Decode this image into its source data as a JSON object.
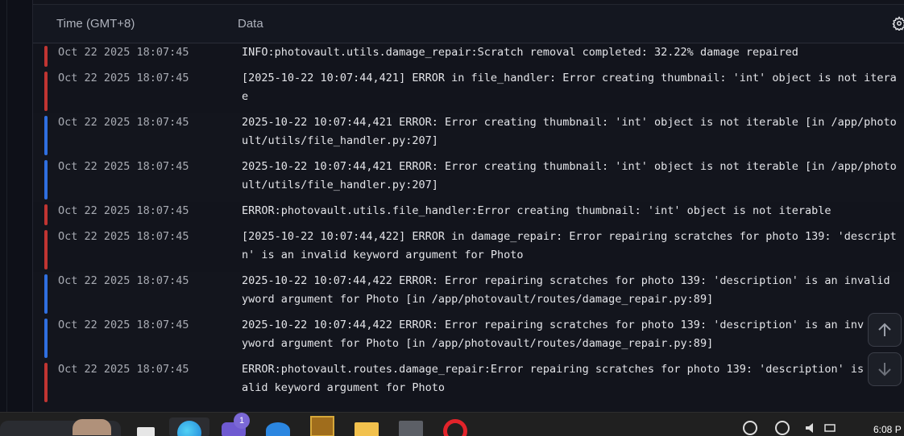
{
  "header": {
    "time_col": "Time (GMT+8)",
    "data_col": "Data"
  },
  "colors": {
    "error": "#c03532",
    "info": "#2f6fe0"
  },
  "rows": [
    {
      "level": "error",
      "time": "Oct 22 2025 18:07:45",
      "lines": [
        "INFO:photovault.utils.damage_repair:Scratch removal completed: 32.22% damage repaired"
      ]
    },
    {
      "level": "error",
      "time": "Oct 22 2025 18:07:45",
      "lines": [
        "[2025-10-22 10:07:44,421] ERROR in file_handler: Error creating thumbnail: 'int' object is not itera",
        "e"
      ]
    },
    {
      "level": "info",
      "time": "Oct 22 2025 18:07:45",
      "lines": [
        "2025-10-22 10:07:44,421 ERROR: Error creating thumbnail: 'int' object is not iterable [in /app/photo",
        "ult/utils/file_handler.py:207]"
      ]
    },
    {
      "level": "info",
      "time": "Oct 22 2025 18:07:45",
      "lines": [
        "2025-10-22 10:07:44,421 ERROR: Error creating thumbnail: 'int' object is not iterable [in /app/photo",
        "ult/utils/file_handler.py:207]"
      ]
    },
    {
      "level": "error",
      "time": "Oct 22 2025 18:07:45",
      "lines": [
        "ERROR:photovault.utils.file_handler:Error creating thumbnail: 'int' object is not iterable"
      ]
    },
    {
      "level": "error",
      "time": "Oct 22 2025 18:07:45",
      "lines": [
        "[2025-10-22 10:07:44,422] ERROR in damage_repair: Error repairing scratches for photo 139: 'descript",
        "n' is an invalid keyword argument for Photo"
      ]
    },
    {
      "level": "info",
      "time": "Oct 22 2025 18:07:45",
      "lines": [
        "2025-10-22 10:07:44,422 ERROR: Error repairing scratches for photo 139: 'description' is an invalid",
        "yword argument for Photo [in /app/photovault/routes/damage_repair.py:89]"
      ]
    },
    {
      "level": "info",
      "time": "Oct 22 2025 18:07:45",
      "lines": [
        "2025-10-22 10:07:44,422 ERROR: Error repairing scratches for photo 139: 'description' is an inv",
        "yword argument for Photo [in /app/photovault/routes/damage_repair.py:89]"
      ]
    },
    {
      "level": "error",
      "time": "Oct 22 2025 18:07:45",
      "lines": [
        "ERROR:photovault.routes.damage_repair:Error repairing scratches for photo 139: 'description' is an i",
        "alid keyword argument for Photo"
      ]
    }
  ],
  "taskbar": {
    "badge_count": "1",
    "clock": "6:08 P"
  }
}
